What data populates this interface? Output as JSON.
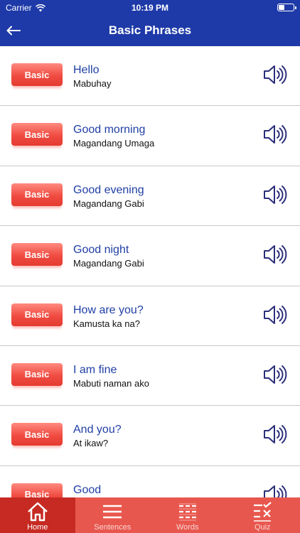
{
  "status_bar": {
    "carrier": "Carrier",
    "time": "10:19 PM",
    "battery_level": 0.35
  },
  "nav": {
    "title": "Basic Phrases"
  },
  "phrases": [
    {
      "tag": "Basic",
      "english": "Hello",
      "filipino": "Mabuhay"
    },
    {
      "tag": "Basic",
      "english": "Good morning",
      "filipino": "Magandang Umaga"
    },
    {
      "tag": "Basic",
      "english": "Good evening",
      "filipino": "Magandang Gabi"
    },
    {
      "tag": "Basic",
      "english": "Good night",
      "filipino": "Magandang Gabi"
    },
    {
      "tag": "Basic",
      "english": "How are you?",
      "filipino": "Kamusta ka na?"
    },
    {
      "tag": "Basic",
      "english": "I am fine",
      "filipino": "Mabuti naman ako"
    },
    {
      "tag": "Basic",
      "english": "And you?",
      "filipino": "At ikaw?"
    },
    {
      "tag": "Basic",
      "english": "Good",
      "filipino": ""
    }
  ],
  "tabs": [
    {
      "label": "Home",
      "icon": "home-icon",
      "active": true
    },
    {
      "label": "Sentences",
      "icon": "menu-icon",
      "active": false
    },
    {
      "label": "Words",
      "icon": "grid-icon",
      "active": false
    },
    {
      "label": "Quiz",
      "icon": "checklist-icon",
      "active": false
    }
  ],
  "colors": {
    "header": "#1e3aa8",
    "tab_bar": "#e8574e",
    "tab_active": "#c62a22",
    "tag": "#f04c42",
    "phrase_english": "#1f3fa5",
    "speaker": "#2b2f7a"
  }
}
